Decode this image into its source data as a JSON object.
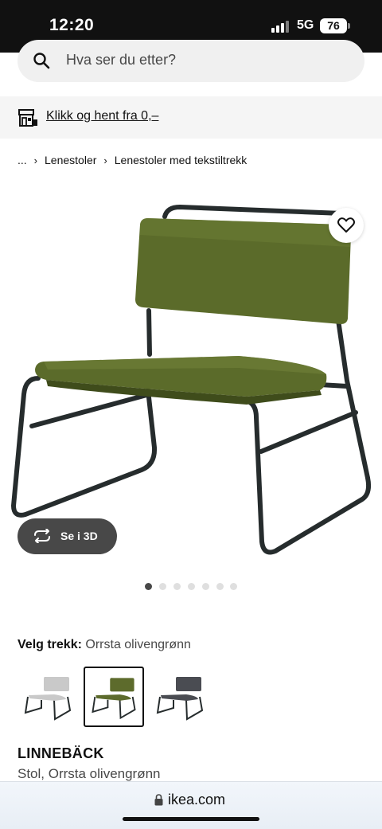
{
  "status_bar": {
    "time": "12:20",
    "network": "5G",
    "battery": "76"
  },
  "search": {
    "placeholder": "Hva ser du etter?"
  },
  "store_banner": {
    "text": "Klikk og hent fra 0,–"
  },
  "breadcrumb": {
    "ellipsis": "...",
    "items": [
      "Lenestoler",
      "Lenestoler med tekstiltrekk"
    ]
  },
  "gallery": {
    "view_3d_label": "Se i 3D",
    "image_count": 7,
    "active_index": 0
  },
  "variants": {
    "heading": "Velg trekk:",
    "selected_value": "Orrsta olivengrønn",
    "options": [
      {
        "color": "#c9c9c9",
        "selected": false
      },
      {
        "color": "#5d6b2c",
        "selected": true
      },
      {
        "color": "#4a4c52",
        "selected": false
      }
    ]
  },
  "product": {
    "name": "LINNEBÄCK",
    "description": "Stol, Orrsta olivengrønn"
  },
  "browser": {
    "url": "ikea.com"
  },
  "colors": {
    "olive": "#5b6b2a",
    "frame": "#262c2d",
    "button_dark": "#484848"
  }
}
